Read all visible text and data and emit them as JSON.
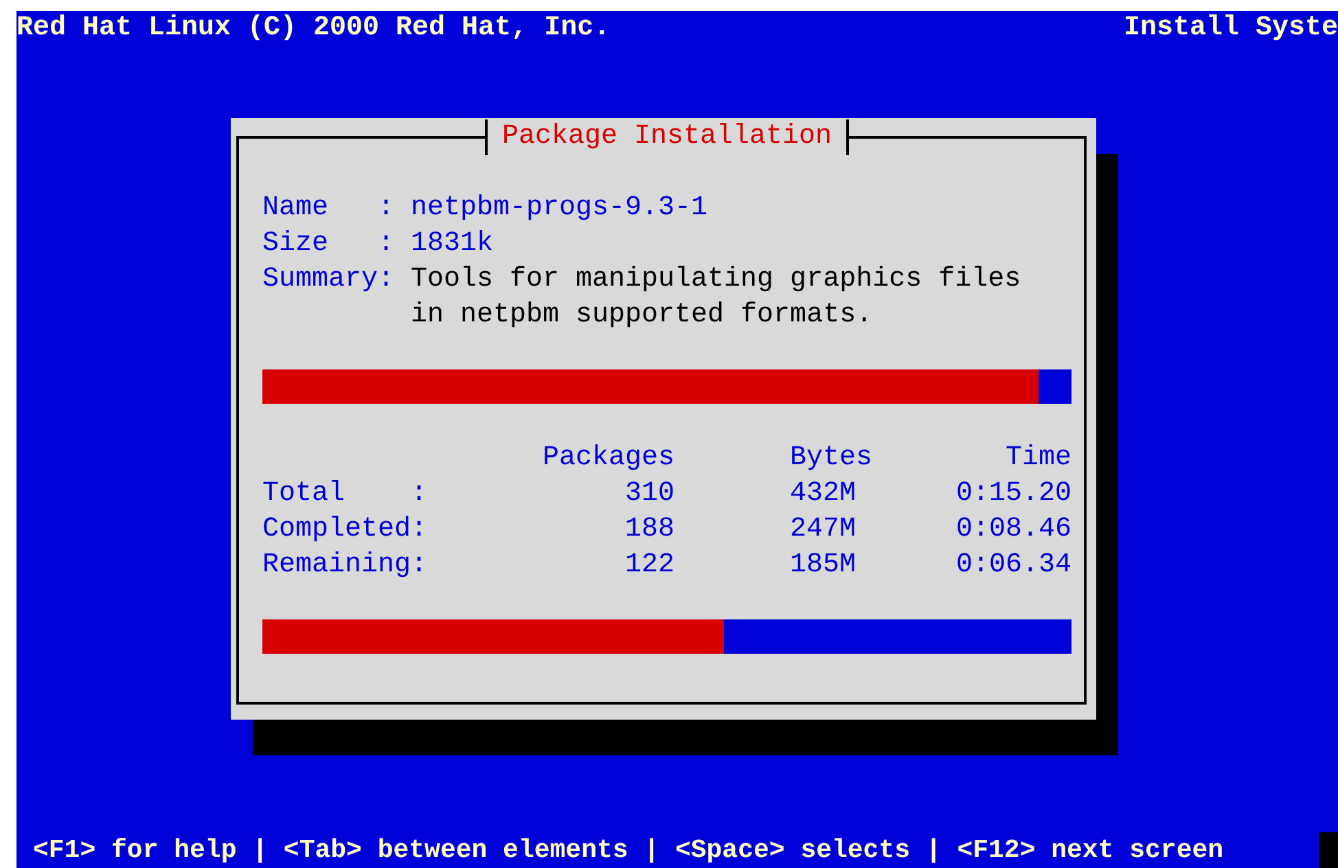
{
  "header": {
    "title": "Red Hat Linux (C) 2000 Red Hat, Inc.",
    "right": "Install Syste"
  },
  "dialog": {
    "title": "Package Installation",
    "fields": [
      {
        "label": "Name   :",
        "value": "netpbm-progs-9.3-1"
      },
      {
        "label": "Size   :",
        "value": "1831k"
      },
      {
        "label": "Summary:",
        "value": "Tools for manipulating graphics files in netpbm supported formats."
      }
    ],
    "package_progress": {
      "level": 0.96
    },
    "table": {
      "columns": [
        "Packages",
        "Bytes",
        "Time"
      ],
      "rows": [
        {
          "label": "Total    :",
          "values": [
            "310",
            "432M",
            "0:15.20"
          ]
        },
        {
          "label": "Completed:",
          "values": [
            "188",
            "247M",
            "0:08.46"
          ]
        },
        {
          "label": "Remaining:",
          "values": [
            "122",
            "185M",
            "0:06.34"
          ]
        }
      ]
    },
    "overall_progress": {
      "level": 0.57
    }
  },
  "help_line": "<F1> for help | <Tab> between elements | <Space> selects | <F12> next screen"
}
